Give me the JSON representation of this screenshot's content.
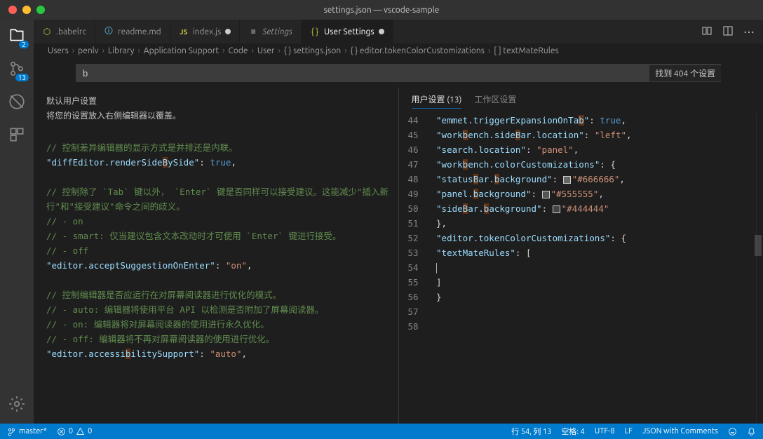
{
  "title": "settings.json — vscode-sample",
  "activity": {
    "explorer_badge": "2",
    "scm_badge": "13"
  },
  "tabs": [
    {
      "icon": "babel",
      "label": ".babelrc",
      "dirty": false
    },
    {
      "icon": "md",
      "label": "readme.md",
      "dirty": false
    },
    {
      "icon": "js",
      "label": "index.js",
      "dirty": true
    },
    {
      "icon": "settings",
      "label": "Settings",
      "dirty": false
    },
    {
      "icon": "json",
      "label": "User Settings",
      "dirty": true,
      "active": true
    }
  ],
  "breadcrumb": [
    "Users",
    "penlv",
    "Library",
    "Application Support",
    "Code",
    "User",
    "{ } settings.json",
    "{ } editor.tokenColorCustomizations",
    "[ ] textMateRules"
  ],
  "search": {
    "value": "b",
    "found": "找到 404 个设置"
  },
  "left": {
    "header": "默认用户设置",
    "subheader": "将您的设置放入右侧编辑器以覆盖。",
    "lines": [
      {
        "t": "cmt",
        "v": "// 控制差异编辑器的显示方式是并排还是内联。"
      },
      {
        "t": "kv",
        "k": "\"diffEditor.renderSideBySide\"",
        "v": "true",
        "vtype": "kw"
      },
      {
        "t": "blank"
      },
      {
        "t": "cmt",
        "v": "// 控制除了 `Tab` 键以外， `Enter` 键是否同样可以接受建议。这能减少\"插入新行\"和\"接受建议\"命令之间的歧义。"
      },
      {
        "t": "cmt",
        "v": "//  - on"
      },
      {
        "t": "cmt",
        "v": "//  - smart: 仅当建议包含文本改动时才可使用 `Enter` 键进行接受。"
      },
      {
        "t": "cmt",
        "v": "//  - off"
      },
      {
        "t": "kv",
        "k": "\"editor.acceptSuggestionOnEnter\"",
        "v": "\"on\"",
        "vtype": "val"
      },
      {
        "t": "blank"
      },
      {
        "t": "cmt",
        "v": "// 控制编辑器是否应运行在对屏幕阅读器进行优化的模式。"
      },
      {
        "t": "cmt",
        "v": "//  - auto: 编辑器将使用平台 API 以检测是否附加了屏幕阅读器。"
      },
      {
        "t": "cmt",
        "v": "//  - on: 编辑器将对屏幕阅读器的使用进行永久优化。"
      },
      {
        "t": "cmt",
        "v": "//  - off: 编辑器将不再对屏幕阅读器的使用进行优化。"
      },
      {
        "t": "kv",
        "k": "\"editor.accessibilitySupport\"",
        "v": "\"auto\"",
        "vtype": "val"
      }
    ]
  },
  "right": {
    "tabs": {
      "user": "用户设置 (13)",
      "workspace": "工作区设置"
    },
    "lines": [
      {
        "n": 44,
        "raw": "    \"emmet.triggerExpansionOnTab\": true,",
        "segs": [
          [
            "key",
            "\"emmet.triggerExpansionOnTab\""
          ],
          [
            "pun",
            ": "
          ],
          [
            "kw",
            "true"
          ],
          [
            "pun",
            ","
          ]
        ]
      },
      {
        "n": 45,
        "raw": "",
        "segs": [
          [
            "key",
            "\"workbench.sideBar.location\""
          ],
          [
            "pun",
            ": "
          ],
          [
            "val",
            "\"left\""
          ],
          [
            "pun",
            ","
          ]
        ]
      },
      {
        "n": 46,
        "raw": "",
        "segs": [
          [
            "key",
            "\"search.location\""
          ],
          [
            "pun",
            ": "
          ],
          [
            "val",
            "\"panel\""
          ],
          [
            "pun",
            ","
          ]
        ]
      },
      {
        "n": 47,
        "raw": "",
        "segs": [
          [
            "key",
            "\"workbench.colorCustomizations\""
          ],
          [
            "pun",
            ": {"
          ]
        ]
      },
      {
        "n": 48,
        "indent": 2,
        "segs": [
          [
            "key",
            "\"statusBar.background\""
          ],
          [
            "pun",
            ": "
          ],
          [
            "box",
            "#666666"
          ],
          [
            "val",
            "\"#666666\""
          ],
          [
            "pun",
            ","
          ]
        ]
      },
      {
        "n": 49,
        "indent": 2,
        "segs": [
          [
            "key",
            "\"panel.background\""
          ],
          [
            "pun",
            ": "
          ],
          [
            "box",
            "#555555"
          ],
          [
            "val",
            "\"#555555\""
          ],
          [
            "pun",
            ","
          ]
        ]
      },
      {
        "n": 50,
        "indent": 2,
        "segs": [
          [
            "key",
            "\"sideBar.background\""
          ],
          [
            "pun",
            ": "
          ],
          [
            "box",
            "#444444"
          ],
          [
            "val",
            "\"#444444\""
          ]
        ]
      },
      {
        "n": 51,
        "segs": [
          [
            "pun",
            "},"
          ]
        ]
      },
      {
        "n": 52,
        "segs": [
          [
            "key",
            "\"editor.tokenColorCustomizations\""
          ],
          [
            "pun",
            ": {"
          ]
        ]
      },
      {
        "n": 53,
        "indent": 2,
        "segs": [
          [
            "key",
            "\"textMateRules\""
          ],
          [
            "pun",
            ": ["
          ]
        ]
      },
      {
        "n": 54,
        "indent": 3,
        "cursor": true,
        "segs": []
      },
      {
        "n": 55,
        "indent": 2,
        "segs": [
          [
            "pun",
            "]"
          ]
        ]
      },
      {
        "n": 56,
        "indent": 1,
        "segs": [
          [
            "pun",
            "}"
          ]
        ]
      },
      {
        "n": 57,
        "segs": []
      },
      {
        "n": 58,
        "segs": []
      }
    ]
  },
  "status": {
    "branch": "master*",
    "errors": "0",
    "warnings": "0",
    "ln": "行 54, 列 13",
    "spaces": "空格: 4",
    "encoding": "UTF-8",
    "eol": "LF",
    "lang": "JSON with Comments"
  }
}
